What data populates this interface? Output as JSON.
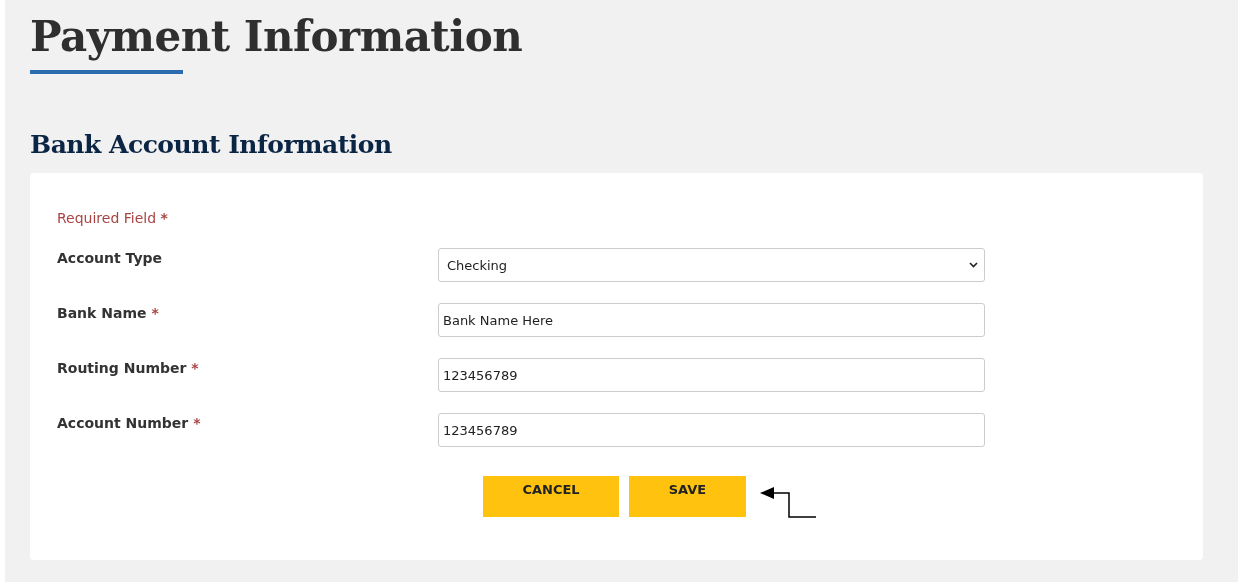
{
  "page_title": "Payment Information",
  "section_title": "Bank Account Information",
  "required_note": {
    "text": "Required Field",
    "mark": "*"
  },
  "fields": [
    {
      "label": "Account Type",
      "kind": "select",
      "value": "Checking"
    },
    {
      "label": "Bank Name",
      "required_mark": "*",
      "kind": "text",
      "value": "Bank Name Here"
    },
    {
      "label": "Routing Number",
      "required_mark": "*",
      "kind": "text",
      "value": "123456789"
    },
    {
      "label": "Account Number",
      "required_mark": "*",
      "kind": "text",
      "value": "123456789"
    }
  ],
  "buttons": [
    "CANCEL",
    "SAVE"
  ]
}
